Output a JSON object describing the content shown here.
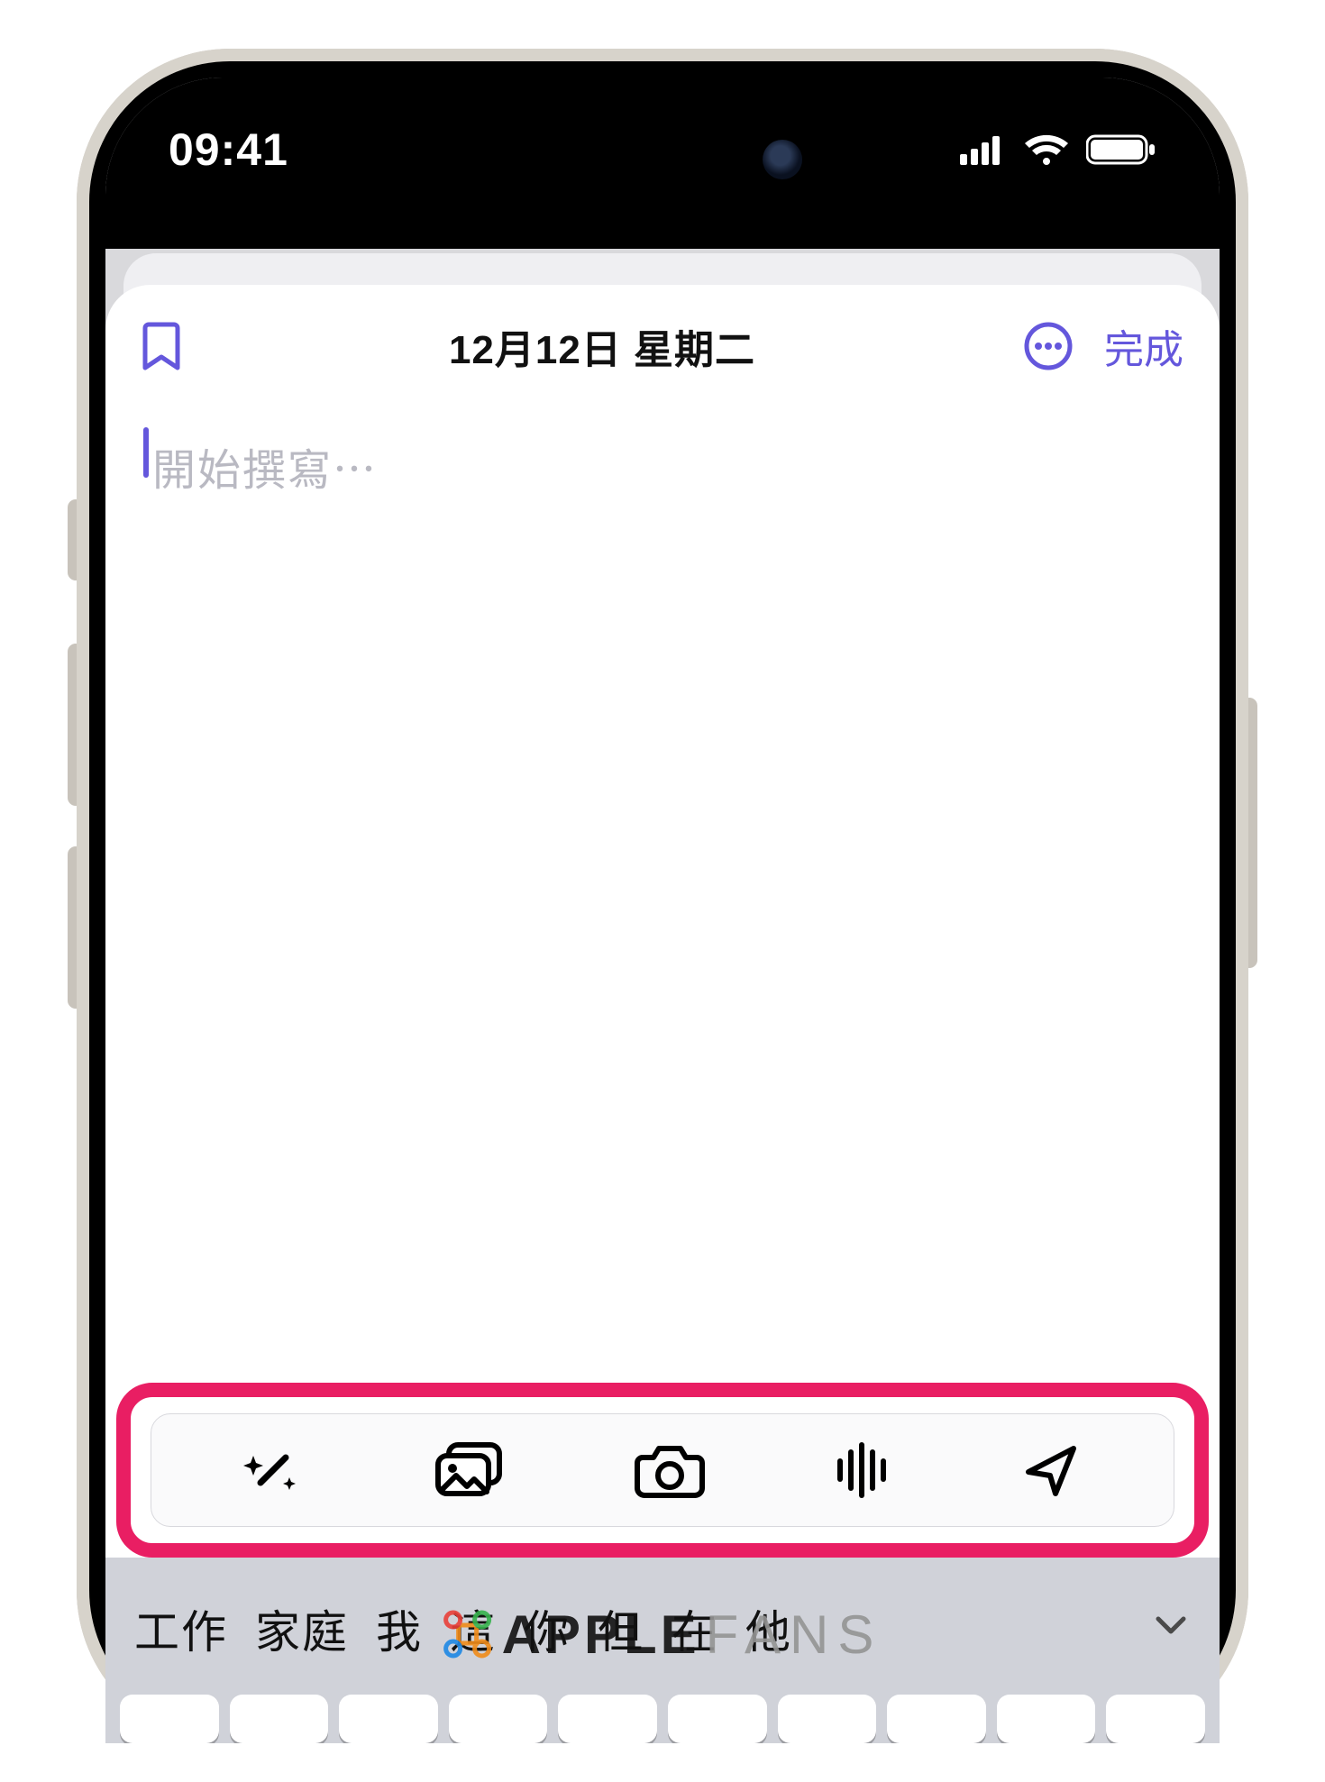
{
  "status": {
    "time": "09:41"
  },
  "header": {
    "title": "12月12日 星期二",
    "done": "完成"
  },
  "editor": {
    "placeholder": "開始撰寫⋯"
  },
  "toolbar": {
    "items": [
      {
        "name": "magic-wand-icon"
      },
      {
        "name": "photo-library-icon"
      },
      {
        "name": "camera-icon"
      },
      {
        "name": "audio-wave-icon"
      },
      {
        "name": "location-arrow-icon"
      }
    ]
  },
  "keyboard": {
    "predictions": [
      "工作",
      "家庭",
      "我",
      "這",
      "你",
      "但",
      "在",
      "他"
    ]
  },
  "watermark": {
    "brand": "APPLE",
    "suffix": "FANS"
  },
  "colors": {
    "accent": "#6457dc",
    "highlight": "#e91e63"
  }
}
